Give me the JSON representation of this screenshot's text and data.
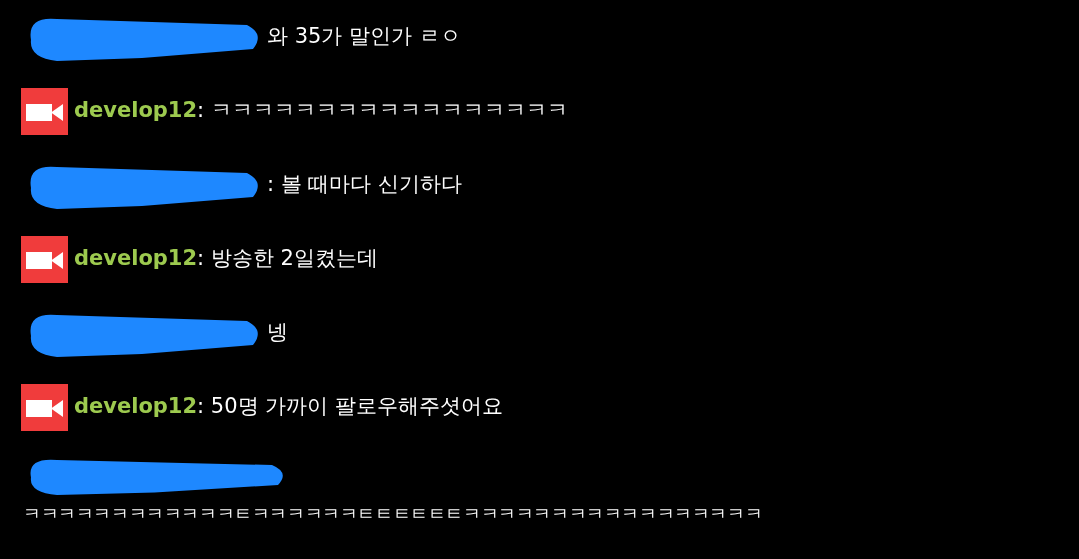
{
  "messages": [
    {
      "kind": "redacted",
      "text": "와 35가 말인가 ㄹㅇ"
    },
    {
      "kind": "streamer",
      "user": "develop12",
      "text": ": ㅋㅋㅋㅋㅋㅋㅋㅋㅋㅋㅋㅋㅋㅋㅋㅋㅋ"
    },
    {
      "kind": "redacted",
      "text": ": 볼 때마다 신기하다"
    },
    {
      "kind": "streamer",
      "user": "develop12",
      "text": ": 방송한 2일켰는데"
    },
    {
      "kind": "redacted",
      "text": "넹"
    },
    {
      "kind": "streamer",
      "user": "develop12",
      "text": ": 50명 가까이 팔로우해주셧어요"
    },
    {
      "kind": "redacted_wrap",
      "text": "ㅋㅋㅋㅋㅋㅋㅋㅋㅋㅋㅋㅋㅌㅋㅋㅋㅋㅋㅋㅌㅌㅌㅌㅌㅌㅋㅋㅋㅋㅋㅋㅋㅋㅋㅋㅋㅋㅋㅋㅋㅋㅋ"
    }
  ]
}
